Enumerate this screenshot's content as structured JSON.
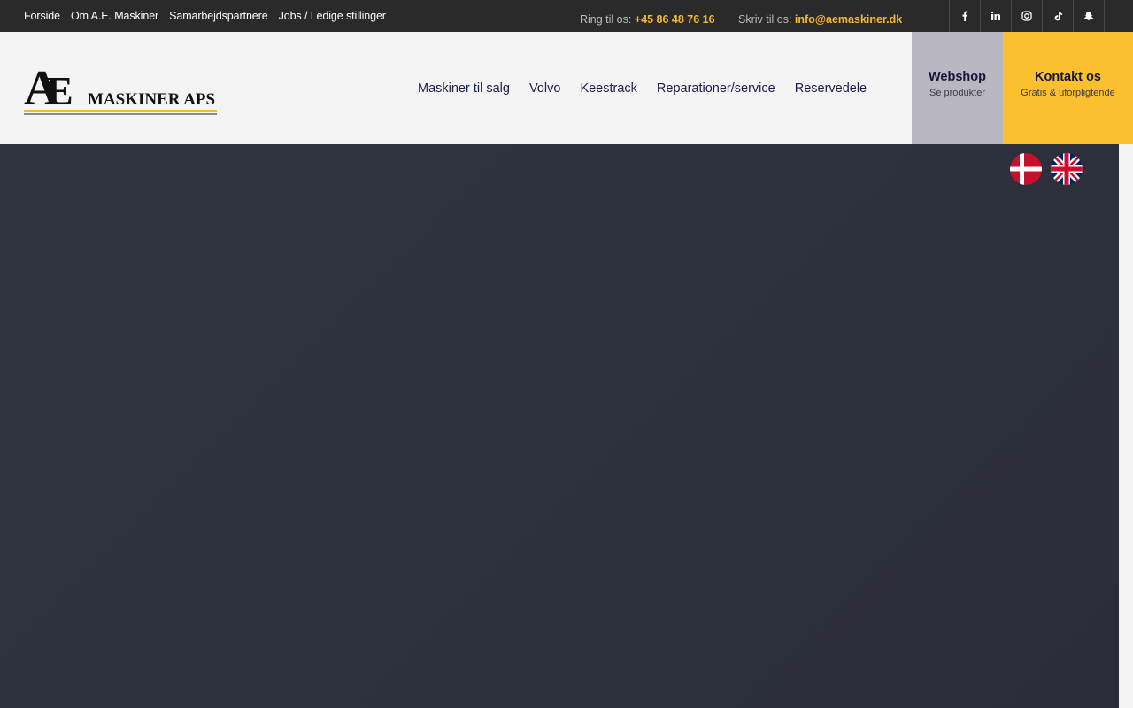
{
  "topbar": {
    "links": [
      "Forside",
      "Om A.E. Maskiner",
      "Samarbejdspartnere",
      "Jobs / Ledige stillinger"
    ],
    "phone_label": "Ring til os:",
    "phone_value": "+45 86 48 76 16",
    "email_label": "Skriv til os:",
    "email_value": "info@aemaskiner.dk",
    "socials": [
      "facebook-icon",
      "linkedin-icon",
      "instagram-icon",
      "tiktok-icon",
      "snapchat-icon"
    ]
  },
  "header": {
    "logo_text": "MASKINER APS",
    "logo_letters": "AE",
    "nav": [
      "Maskiner til salg",
      "Volvo",
      "Keestrack",
      "Reparationer/service",
      "Reservedele"
    ],
    "webshop": {
      "title": "Webshop",
      "subtitle": "Se produkter"
    },
    "kontakt": {
      "title": "Kontakt os",
      "subtitle": "Gratis & uforpligtende"
    }
  },
  "languages": [
    "danish-flag-icon",
    "uk-flag-icon"
  ],
  "colors": {
    "accent": "#fbc02d",
    "highlight": "#f6b82c",
    "nav_text": "#1c1c4a",
    "topbar": "#2a2a2a",
    "hero": "#2d313b"
  }
}
